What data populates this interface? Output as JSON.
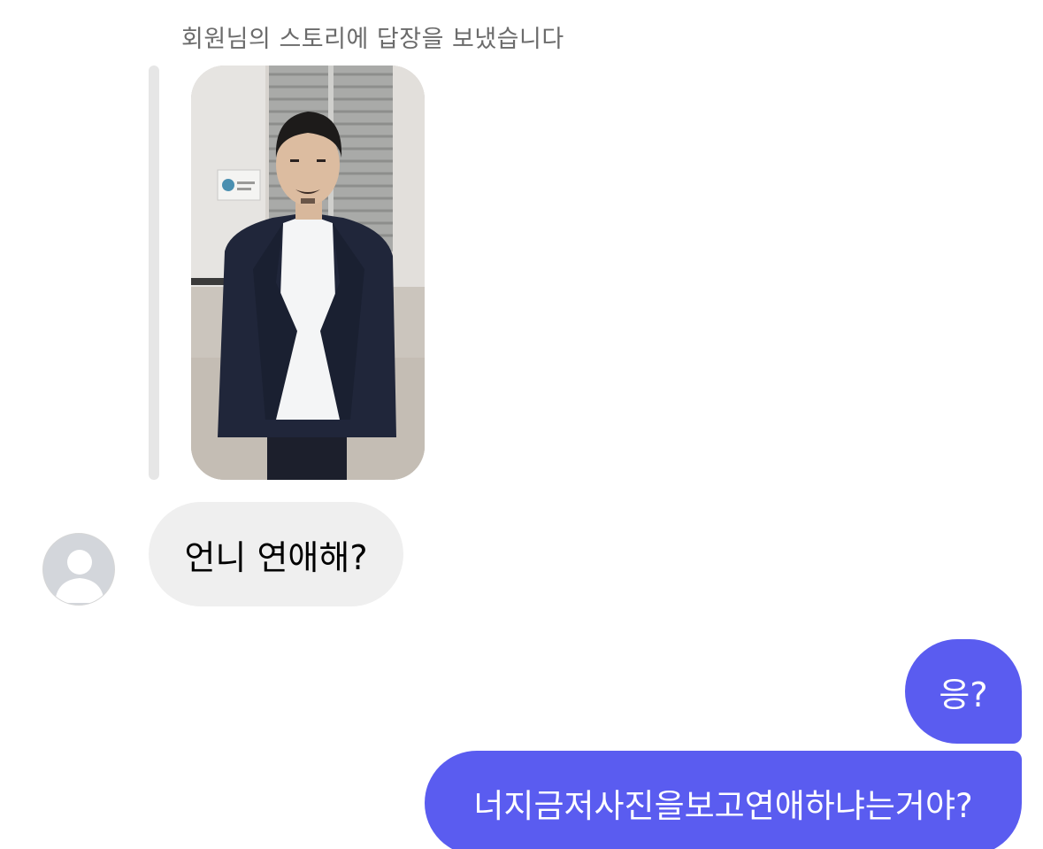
{
  "story_reply": {
    "caption": "회원님의 스토리에 답장을 보냈습니다"
  },
  "messages": [
    {
      "sender": "other",
      "text": "언니 연애해?"
    },
    {
      "sender": "me",
      "text": "응?"
    },
    {
      "sender": "me",
      "text": "너지금저사진을보고연애하냐는거야?"
    }
  ],
  "colors": {
    "sent_bubble": "#5a5cf0",
    "received_bubble": "#efefef",
    "caption_text": "#6b6b6b",
    "reply_bar": "#e6e6e6"
  },
  "icons": {
    "avatar": "default-profile-silhouette-icon"
  }
}
